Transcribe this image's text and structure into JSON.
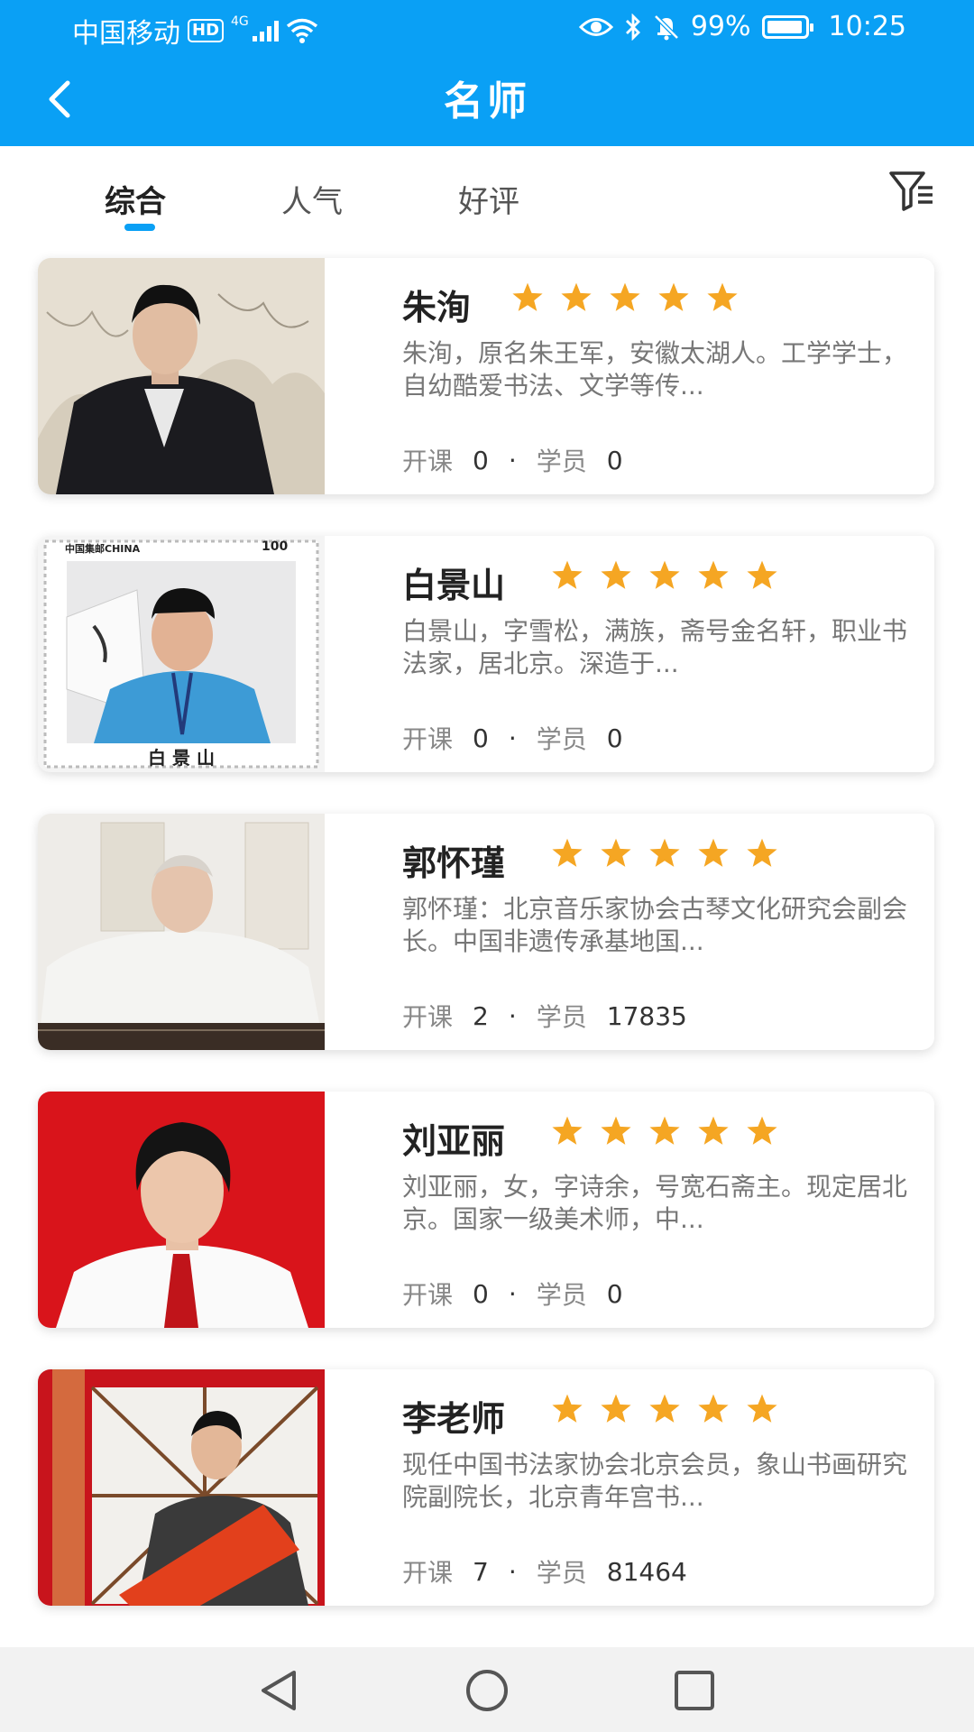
{
  "status_bar": {
    "carrier": "中国移动",
    "hd": "HD",
    "network": "4G",
    "battery": "99%",
    "time": "10:25"
  },
  "header": {
    "title": "名师",
    "back_icon": "chevron-left-icon"
  },
  "tabs": [
    {
      "label": "综合",
      "active": true
    },
    {
      "label": "人气",
      "active": false
    },
    {
      "label": "好评",
      "active": false
    }
  ],
  "filter_icon": "filter-icon",
  "teachers": [
    {
      "name": "朱洵",
      "rating": 5,
      "desc": "朱洵，原名朱王军，安徽太湖人。工学学士，自幼酷爱书法、文学等传...",
      "courses_label": "开课",
      "courses": "0",
      "students_label": "学员",
      "students": "0"
    },
    {
      "name": "白景山",
      "rating": 5,
      "desc": "白景山，字雪松，满族，斋号金名轩，职业书法家，居北京。深造于...",
      "courses_label": "开课",
      "courses": "0",
      "students_label": "学员",
      "students": "0",
      "stamp_top_left": "中国集邮CHINA",
      "stamp_top_right": "100",
      "stamp_caption": "白 景 山"
    },
    {
      "name": "郭怀瑾",
      "rating": 5,
      "desc": "郭怀瑾：北京音乐家协会古琴文化研究会副会长。中国非遗传承基地国...",
      "courses_label": "开课",
      "courses": "2",
      "students_label": "学员",
      "students": "17835"
    },
    {
      "name": "刘亚丽",
      "rating": 5,
      "desc": "刘亚丽，女，字诗余，号宽石斋主。现定居北京。国家一级美术师，中...",
      "courses_label": "开课",
      "courses": "0",
      "students_label": "学员",
      "students": "0"
    },
    {
      "name": "李老师",
      "rating": 5,
      "desc": "现任中国书法家协会北京会员，象山书画研究院副院长，北京青年宫书...",
      "courses_label": "开课",
      "courses": "7",
      "students_label": "学员",
      "students": "81464"
    }
  ],
  "colors": {
    "primary": "#0aa0f5",
    "star": "#f5a623"
  },
  "system_nav": [
    "back-triangle-icon",
    "home-circle-icon",
    "recents-square-icon"
  ]
}
